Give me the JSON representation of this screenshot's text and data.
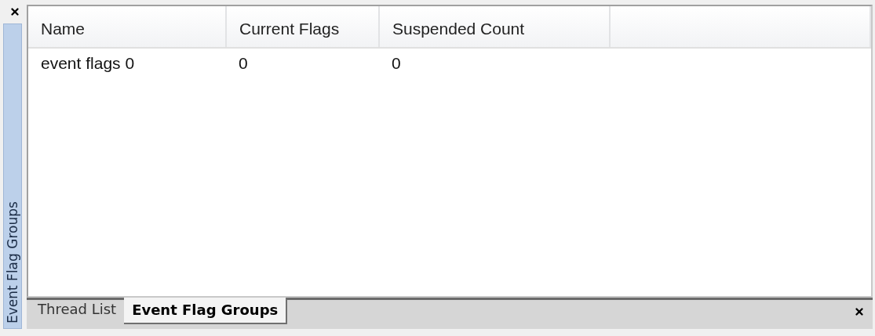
{
  "side_panel": {
    "title": "Event Flag Groups"
  },
  "table": {
    "columns": [
      "Name",
      "Current Flags",
      "Suspended Count"
    ],
    "rows": [
      [
        "event flags 0",
        "0",
        "0"
      ]
    ]
  },
  "tabs": [
    {
      "label": "Thread List",
      "selected": false
    },
    {
      "label": "Event Flag Groups",
      "selected": true
    }
  ]
}
